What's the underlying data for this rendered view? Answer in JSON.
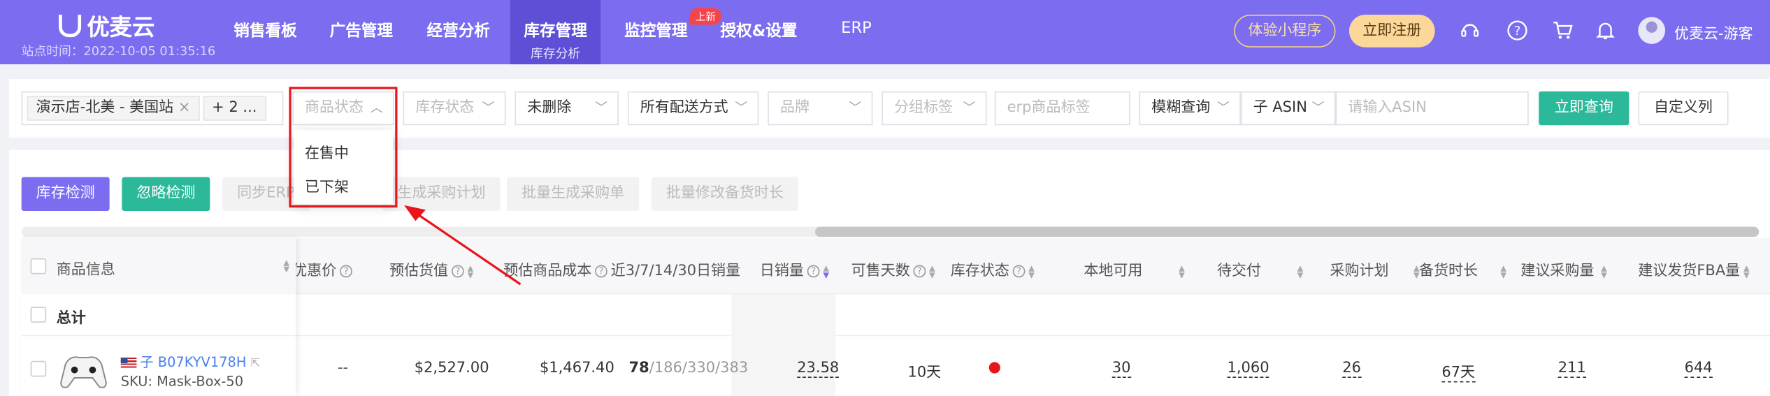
{
  "brand": {
    "name": "优麦云",
    "site_time": "站点时间：2022-10-05 01:35:16"
  },
  "nav": {
    "items": [
      "销售看板",
      "广告管理",
      "经营分析",
      "库存管理",
      "监控管理",
      "授权&设置",
      "ERP"
    ],
    "active_sub": "库存分析",
    "badge": "上新"
  },
  "header": {
    "mini_program": "体验小程序",
    "register": "立即注册",
    "user": "优麦云-游客"
  },
  "filters": {
    "shop_tag": "演示店-北美 - 美国站",
    "more_tag": "+ 2 ...",
    "product_status": "商品状态",
    "stock_status": "库存状态",
    "deleted": "未删除",
    "delivery": "所有配送方式",
    "brand": "品牌",
    "group_tag": "分组标签",
    "erp_tag_placeholder": "erp商品标签",
    "match": "模糊查询",
    "asin_type": "子 ASIN",
    "asin_placeholder": "请输入ASIN",
    "query": "立即查询",
    "custom": "自定义列"
  },
  "dropdown": {
    "options": [
      "在售中",
      "已下架"
    ]
  },
  "actions": {
    "stock_check": "库存检测",
    "ignore_check": "忽略检测",
    "sync_erp": "同步ERP",
    "gen_plan": "生成采购计划",
    "batch_order": "批量生成采购单",
    "batch_lead": "批量修改备货时长"
  },
  "table": {
    "headers": [
      "商品信息",
      "优惠价",
      "预估货值",
      "预估商品成本",
      "近3/7/14/30日销量",
      "日销量",
      "可售天数",
      "库存状态",
      "本地可用",
      "待交付",
      "采购计划",
      "备货时长",
      "建议采购量",
      "建议发货FBA量"
    ],
    "total_label": "总计",
    "row": {
      "asin": "子 B07KYV178H",
      "sku": "SKU: Mask-Box-50",
      "discount": "--",
      "est_value": "$2,527.00",
      "est_cost": "$1,467.40",
      "sales_bold": "78",
      "sales_rest": "/186/330/383",
      "daily": "23.58",
      "days": "10天",
      "local": "30",
      "pending": "1,060",
      "plan": "26",
      "lead": "67天",
      "suggest_buy": "211",
      "suggest_fba": "644"
    }
  }
}
